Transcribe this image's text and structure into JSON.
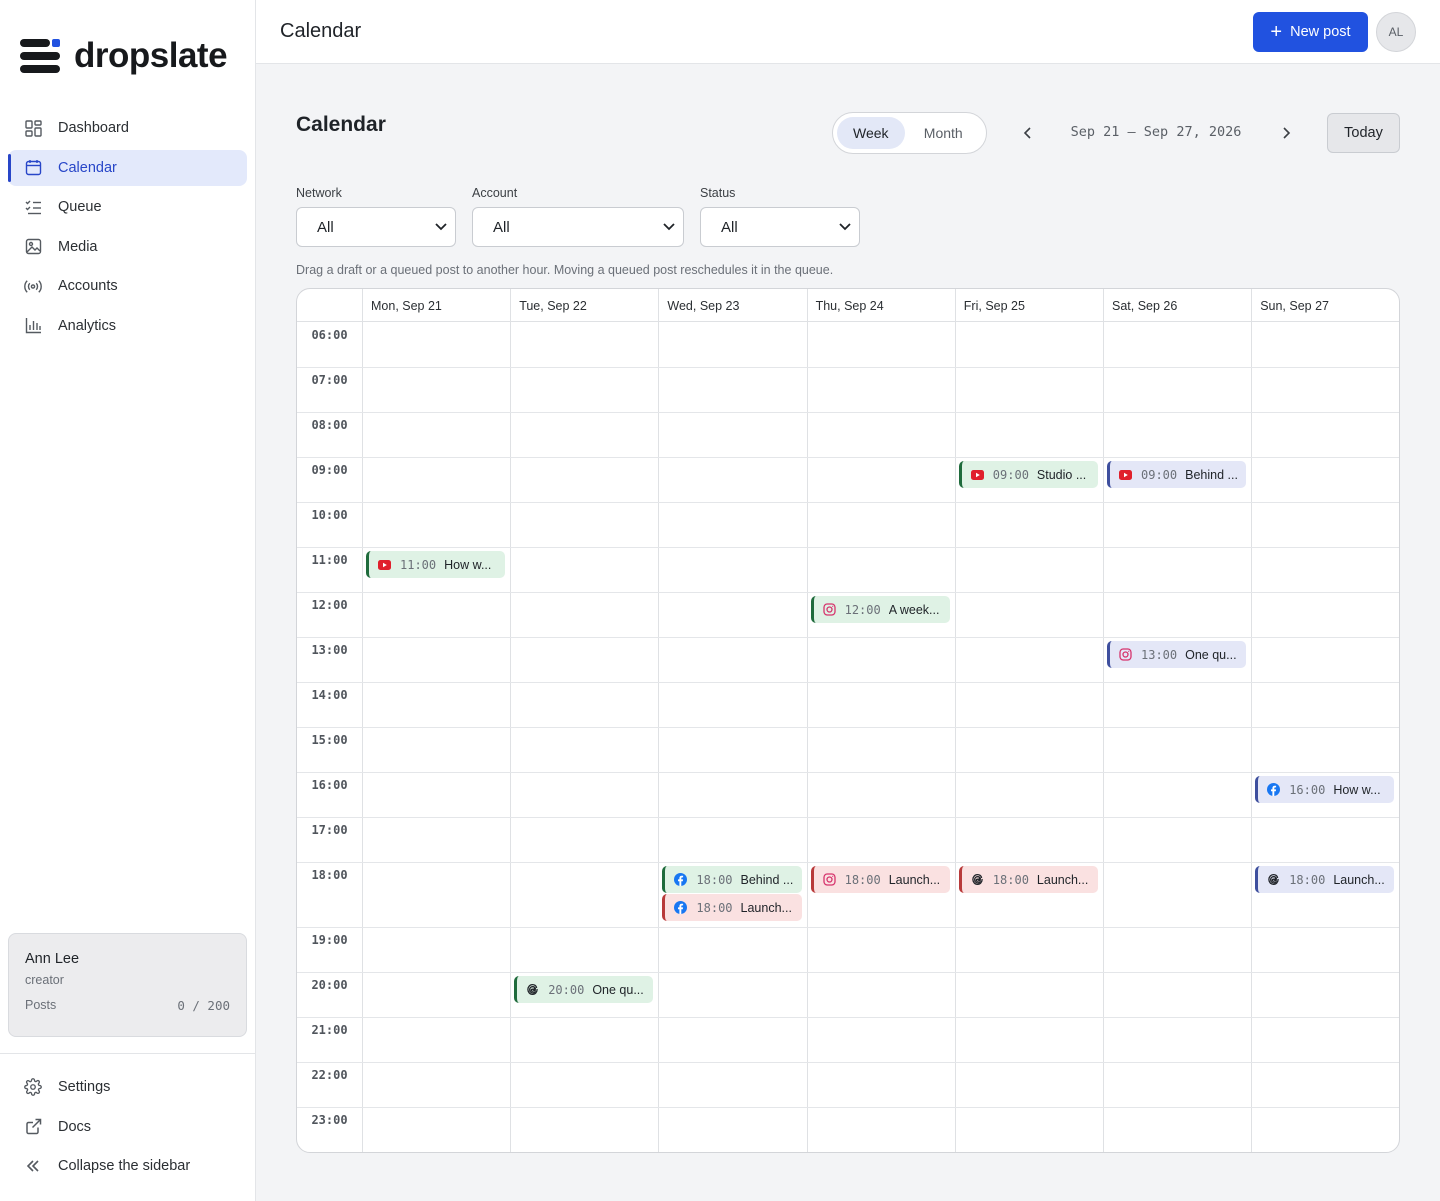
{
  "brand": {
    "name": "dropslate"
  },
  "sidebar": {
    "items": [
      {
        "label": "Dashboard",
        "icon": "dashboard-icon"
      },
      {
        "label": "Calendar",
        "icon": "calendar-icon",
        "active": true
      },
      {
        "label": "Queue",
        "icon": "queue-icon"
      },
      {
        "label": "Media",
        "icon": "image-icon"
      },
      {
        "label": "Accounts",
        "icon": "broadcast-icon"
      },
      {
        "label": "Analytics",
        "icon": "bar-chart-icon"
      }
    ],
    "user": {
      "name": "Ann Lee",
      "role": "creator",
      "posts_label": "Posts",
      "posts_value": "0 / 200"
    },
    "bottom_items": [
      {
        "label": "Settings",
        "icon": "gear-icon"
      },
      {
        "label": "Docs",
        "icon": "external-link-icon"
      },
      {
        "label": "Collapse the sidebar",
        "icon": "double-chevron-left-icon"
      }
    ]
  },
  "topbar": {
    "title": "Calendar",
    "new_post_label": "New post",
    "avatar_initials": "AL"
  },
  "main": {
    "heading": "Calendar",
    "view_toggle": {
      "options": [
        "Week",
        "Month"
      ],
      "selected": "Week"
    },
    "date_range": "Sep 21 – Sep 27, 2026",
    "today_label": "Today",
    "filters": [
      {
        "label": "Network",
        "value": "All"
      },
      {
        "label": "Account",
        "value": "All"
      },
      {
        "label": "Status",
        "value": "All"
      }
    ],
    "hint": "Drag a draft or a queued post to another hour. Moving a queued post reschedules it in the queue."
  },
  "calendar": {
    "days": [
      "Mon, Sep 21",
      "Tue, Sep 22",
      "Wed, Sep 23",
      "Thu, Sep 24",
      "Fri, Sep 25",
      "Sat, Sep 26",
      "Sun, Sep 27"
    ],
    "hours": [
      "06:00",
      "07:00",
      "08:00",
      "09:00",
      "10:00",
      "11:00",
      "12:00",
      "13:00",
      "14:00",
      "15:00",
      "16:00",
      "17:00",
      "18:00",
      "19:00",
      "20:00",
      "21:00",
      "22:00",
      "23:00"
    ],
    "colors": {
      "green": "#1f6b3c",
      "red": "#b83a3a",
      "blue": "#3e4f9e",
      "youtube": "#e0202c",
      "instagram": "#d6336c",
      "facebook": "#1877f2",
      "threads": "#1f2328"
    },
    "events": [
      {
        "day": 0,
        "hour": "11:00",
        "network": "youtube",
        "time": "11:00",
        "title": "How w...",
        "color": "green"
      },
      {
        "day": 1,
        "hour": "20:00",
        "network": "threads",
        "time": "20:00",
        "title": "One qu...",
        "color": "green"
      },
      {
        "day": 2,
        "hour": "18:00",
        "network": "facebook",
        "time": "18:00",
        "title": "Behind ...",
        "color": "green"
      },
      {
        "day": 2,
        "hour": "18:00",
        "network": "facebook",
        "time": "18:00",
        "title": "Launch...",
        "color": "red"
      },
      {
        "day": 3,
        "hour": "12:00",
        "network": "instagram",
        "time": "12:00",
        "title": "A week...",
        "color": "green"
      },
      {
        "day": 3,
        "hour": "18:00",
        "network": "instagram",
        "time": "18:00",
        "title": "Launch...",
        "color": "red"
      },
      {
        "day": 4,
        "hour": "09:00",
        "network": "youtube",
        "time": "09:00",
        "title": "Studio ...",
        "color": "green"
      },
      {
        "day": 4,
        "hour": "18:00",
        "network": "threads",
        "time": "18:00",
        "title": "Launch...",
        "color": "red"
      },
      {
        "day": 5,
        "hour": "09:00",
        "network": "youtube",
        "time": "09:00",
        "title": "Behind ...",
        "color": "blue"
      },
      {
        "day": 5,
        "hour": "13:00",
        "network": "instagram",
        "time": "13:00",
        "title": "One qu...",
        "color": "blue"
      },
      {
        "day": 6,
        "hour": "16:00",
        "network": "facebook",
        "time": "16:00",
        "title": "How w...",
        "color": "blue"
      },
      {
        "day": 6,
        "hour": "18:00",
        "network": "threads",
        "time": "18:00",
        "title": "Launch...",
        "color": "blue"
      }
    ]
  }
}
